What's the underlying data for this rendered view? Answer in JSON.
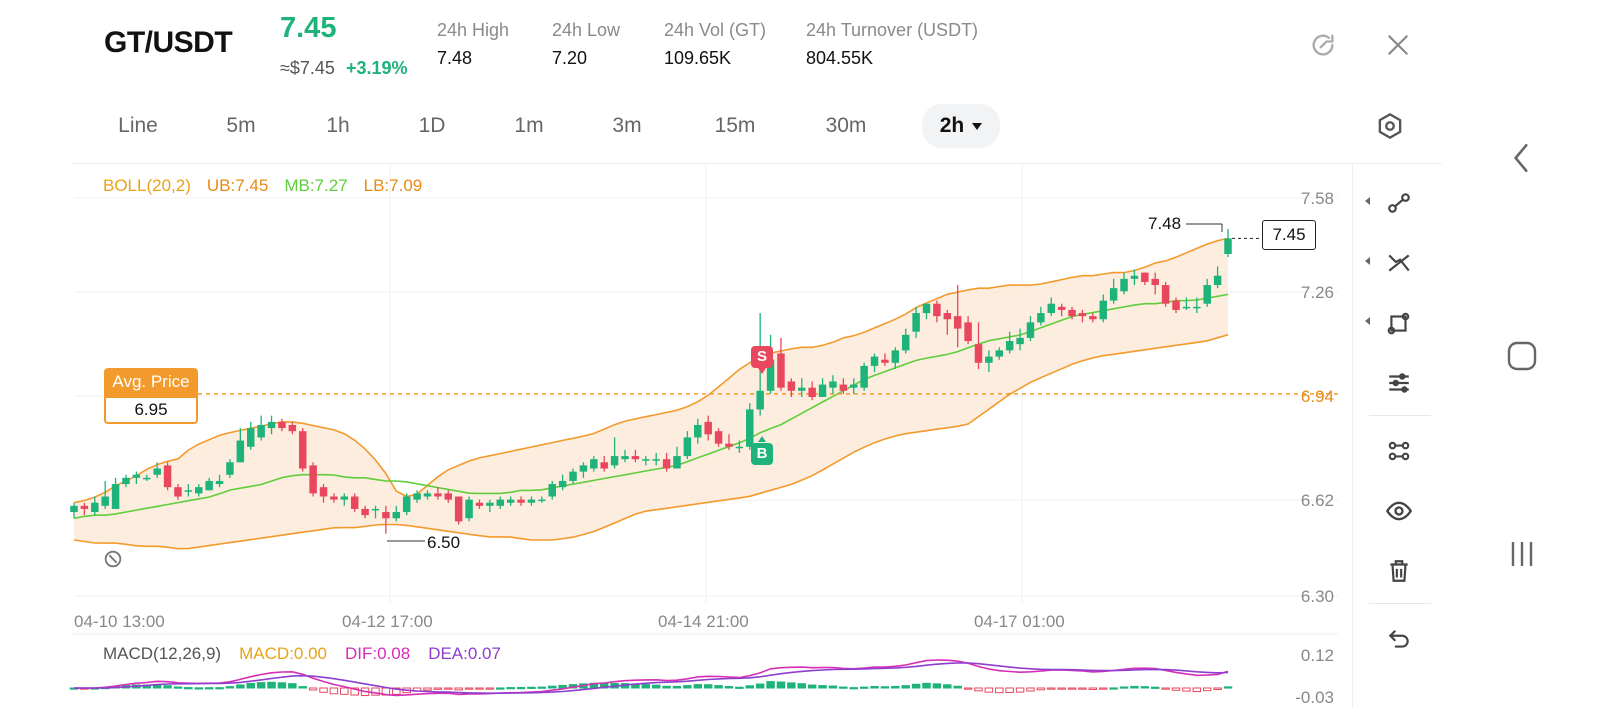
{
  "header": {
    "pair": "GT/USDT",
    "last_price": "7.45",
    "fiat_price": "≈$7.45",
    "change_pct": "+3.19%",
    "stats": [
      {
        "label": "24h   High",
        "value": "7.48"
      },
      {
        "label": "24h   Low",
        "value": "7.20"
      },
      {
        "label": "24h   Vol (GT)",
        "value": "109.65K"
      },
      {
        "label": "24h   Turnover (USDT)",
        "value": "804.55K"
      }
    ]
  },
  "tabs": [
    "Line",
    "5m",
    "1h",
    "1D",
    "1m",
    "3m",
    "15m",
    "30m",
    "2h"
  ],
  "active_tab": "2h",
  "indicators": {
    "boll": {
      "name": "BOLL(20,2)",
      "ub": "UB:7.45",
      "mb": "MB:7.27",
      "lb": "LB:7.09"
    },
    "macd": {
      "name": "MACD(12,26,9)",
      "macd": "MACD:0.00",
      "dif": "DIF:0.08",
      "dea": "DEA:0.07"
    }
  },
  "colors": {
    "up": "#1db37a",
    "down": "#e8475d",
    "boll_band": "#f39a2c",
    "boll_mid": "#5fcd3c",
    "boll_fill": "#fde9d6",
    "dif": "#d62fb4",
    "dea": "#8e3ecf",
    "boll_label": "#e8a317"
  },
  "chart": {
    "avg_price_label": "Avg. Price",
    "avg_price_value": "6.95",
    "current_price_tag": "7.45",
    "high_marker": "7.48",
    "low_marker": "6.50",
    "sell_marker": "S",
    "buy_marker": "B",
    "y_ticks": [
      "7.58",
      "7.26",
      "6.94",
      "6.62",
      "6.30"
    ],
    "x_ticks": [
      "04-10 13:00",
      "04-12 17:00",
      "04-14 21:00",
      "04-17 01:00"
    ],
    "macd_ticks": [
      "0.12",
      "-0.03"
    ]
  },
  "chart_data": {
    "type": "candlestick",
    "ylim": [
      6.3,
      7.58
    ],
    "macd_ylim": [
      -0.03,
      0.12
    ],
    "candles": [
      [
        6.57,
        6.59,
        6.55,
        6.6
      ],
      [
        6.59,
        6.58,
        6.56,
        6.6
      ],
      [
        6.57,
        6.6,
        6.56,
        6.62
      ],
      [
        6.59,
        6.62,
        6.58,
        6.67
      ],
      [
        6.58,
        6.66,
        6.58,
        6.68
      ],
      [
        6.66,
        6.68,
        6.65,
        6.69
      ],
      [
        6.68,
        6.69,
        6.66,
        6.7
      ],
      [
        6.68,
        6.68,
        6.67,
        6.69
      ],
      [
        6.69,
        6.71,
        6.68,
        6.73
      ],
      [
        6.72,
        6.65,
        6.64,
        6.73
      ],
      [
        6.65,
        6.62,
        6.61,
        6.66
      ],
      [
        6.64,
        6.64,
        6.62,
        6.66
      ],
      [
        6.63,
        6.65,
        6.62,
        6.66
      ],
      [
        6.64,
        6.67,
        6.64,
        6.68
      ],
      [
        6.66,
        6.67,
        6.65,
        6.69
      ],
      [
        6.69,
        6.73,
        6.68,
        6.74
      ],
      [
        6.73,
        6.8,
        6.73,
        6.84
      ],
      [
        6.78,
        6.84,
        6.77,
        6.86
      ],
      [
        6.81,
        6.85,
        6.8,
        6.88
      ],
      [
        6.84,
        6.86,
        6.82,
        6.88
      ],
      [
        6.86,
        6.84,
        6.83,
        6.87
      ],
      [
        6.85,
        6.83,
        6.82,
        6.86
      ],
      [
        6.83,
        6.71,
        6.7,
        6.84
      ],
      [
        6.72,
        6.63,
        6.62,
        6.73
      ],
      [
        6.65,
        6.62,
        6.6,
        6.66
      ],
      [
        6.62,
        6.61,
        6.6,
        6.63
      ],
      [
        6.61,
        6.62,
        6.59,
        6.63
      ],
      [
        6.62,
        6.58,
        6.57,
        6.63
      ],
      [
        6.58,
        6.56,
        6.55,
        6.59
      ],
      [
        6.58,
        6.58,
        6.55,
        6.59
      ],
      [
        6.57,
        6.55,
        6.5,
        6.59
      ],
      [
        6.55,
        6.57,
        6.54,
        6.59
      ],
      [
        6.57,
        6.62,
        6.56,
        6.63
      ],
      [
        6.61,
        6.63,
        6.6,
        6.64
      ],
      [
        6.62,
        6.63,
        6.61,
        6.64
      ],
      [
        6.63,
        6.62,
        6.61,
        6.65
      ],
      [
        6.63,
        6.61,
        6.6,
        6.64
      ],
      [
        6.62,
        6.54,
        6.53,
        6.62
      ],
      [
        6.55,
        6.61,
        6.54,
        6.62
      ],
      [
        6.6,
        6.59,
        6.58,
        6.61
      ],
      [
        6.59,
        6.6,
        6.57,
        6.61
      ],
      [
        6.59,
        6.61,
        6.58,
        6.62
      ],
      [
        6.6,
        6.61,
        6.59,
        6.62
      ],
      [
        6.61,
        6.6,
        6.59,
        6.62
      ],
      [
        6.6,
        6.61,
        6.59,
        6.62
      ],
      [
        6.61,
        6.61,
        6.6,
        6.62
      ],
      [
        6.62,
        6.66,
        6.61,
        6.67
      ],
      [
        6.65,
        6.67,
        6.64,
        6.69
      ],
      [
        6.67,
        6.7,
        6.66,
        6.71
      ],
      [
        6.7,
        6.72,
        6.68,
        6.73
      ],
      [
        6.71,
        6.74,
        6.7,
        6.75
      ],
      [
        6.73,
        6.71,
        6.7,
        6.75
      ],
      [
        6.72,
        6.75,
        6.71,
        6.81
      ],
      [
        6.74,
        6.75,
        6.73,
        6.77
      ],
      [
        6.75,
        6.74,
        6.73,
        6.77
      ],
      [
        6.74,
        6.74,
        6.72,
        6.75
      ],
      [
        6.74,
        6.74,
        6.72,
        6.76
      ],
      [
        6.74,
        6.71,
        6.7,
        6.76
      ],
      [
        6.71,
        6.75,
        6.71,
        6.78
      ],
      [
        6.75,
        6.81,
        6.74,
        6.83
      ],
      [
        6.81,
        6.85,
        6.79,
        6.87
      ],
      [
        6.86,
        6.82,
        6.8,
        6.88
      ],
      [
        6.83,
        6.79,
        6.78,
        6.84
      ],
      [
        6.79,
        6.78,
        6.77,
        6.82
      ],
      [
        6.78,
        6.78,
        6.76,
        6.8
      ],
      [
        6.78,
        6.9,
        6.77,
        6.92
      ],
      [
        6.9,
        6.96,
        6.88,
        7.21
      ],
      [
        6.96,
        7.06,
        6.95,
        7.14
      ],
      [
        7.08,
        6.97,
        6.96,
        7.13
      ],
      [
        6.99,
        6.96,
        6.94,
        7.0
      ],
      [
        6.96,
        6.97,
        6.94,
        7.0
      ],
      [
        6.97,
        6.94,
        6.93,
        6.99
      ],
      [
        6.94,
        6.98,
        6.94,
        7.0
      ],
      [
        6.97,
        6.99,
        6.95,
        7.01
      ],
      [
        6.98,
        6.96,
        6.95,
        7.0
      ],
      [
        6.97,
        6.98,
        6.95,
        7.0
      ],
      [
        6.97,
        7.04,
        6.96,
        7.05
      ],
      [
        7.04,
        7.07,
        7.02,
        7.08
      ],
      [
        7.06,
        7.05,
        7.04,
        7.08
      ],
      [
        7.05,
        7.09,
        7.03,
        7.1
      ],
      [
        7.09,
        7.14,
        7.08,
        7.16
      ],
      [
        7.15,
        7.21,
        7.13,
        7.23
      ],
      [
        7.21,
        7.24,
        7.19,
        7.24
      ],
      [
        7.24,
        7.2,
        7.18,
        7.25
      ],
      [
        7.21,
        7.19,
        7.14,
        7.22
      ],
      [
        7.2,
        7.16,
        7.1,
        7.3
      ],
      [
        7.18,
        7.12,
        7.11,
        7.2
      ],
      [
        7.11,
        7.05,
        7.03,
        7.18
      ],
      [
        7.05,
        7.07,
        7.02,
        7.09
      ],
      [
        7.07,
        7.09,
        7.06,
        7.1
      ],
      [
        7.09,
        7.12,
        7.08,
        7.15
      ],
      [
        7.11,
        7.13,
        7.09,
        7.16
      ],
      [
        7.13,
        7.18,
        7.12,
        7.2
      ],
      [
        7.18,
        7.21,
        7.17,
        7.23
      ],
      [
        7.21,
        7.24,
        7.2,
        7.26
      ],
      [
        7.23,
        7.22,
        7.2,
        7.24
      ],
      [
        7.22,
        7.2,
        7.19,
        7.23
      ],
      [
        7.21,
        7.2,
        7.18,
        7.22
      ],
      [
        7.2,
        7.19,
        7.18,
        7.21
      ],
      [
        7.19,
        7.25,
        7.18,
        7.27
      ],
      [
        7.25,
        7.29,
        7.24,
        7.32
      ],
      [
        7.28,
        7.32,
        7.27,
        7.34
      ],
      [
        7.32,
        7.33,
        7.3,
        7.35
      ],
      [
        7.34,
        7.31,
        7.3,
        7.34
      ],
      [
        7.32,
        7.3,
        7.27,
        7.34
      ],
      [
        7.3,
        7.24,
        7.23,
        7.31
      ],
      [
        7.25,
        7.22,
        7.21,
        7.26
      ],
      [
        7.23,
        7.23,
        7.22,
        7.26
      ],
      [
        7.23,
        7.23,
        7.21,
        7.26
      ],
      [
        7.24,
        7.3,
        7.23,
        7.32
      ],
      [
        7.3,
        7.33,
        7.29,
        7.36
      ],
      [
        7.4,
        7.45,
        7.39,
        7.48
      ]
    ],
    "boll_ub": [
      6.6,
      6.61,
      6.63,
      6.66,
      6.68,
      6.71,
      6.73,
      6.74,
      6.78,
      6.8,
      6.82,
      6.83,
      6.84,
      6.85,
      6.86,
      6.86,
      6.85,
      6.84,
      6.83,
      6.8,
      6.76,
      6.7,
      6.62,
      6.62,
      6.66,
      6.7,
      6.72,
      6.74,
      6.75,
      6.76,
      6.77,
      6.78,
      6.79,
      6.8,
      6.81,
      6.82,
      6.84,
      6.86,
      6.87,
      6.88,
      6.89,
      6.9,
      6.92,
      6.95,
      6.99,
      7.03,
      7.06,
      7.08,
      7.09,
      7.1,
      7.1,
      7.11,
      7.13,
      7.14,
      7.16,
      7.18,
      7.2,
      7.23,
      7.25,
      7.27,
      7.28,
      7.29,
      7.29,
      7.3,
      7.3,
      7.3,
      7.31,
      7.32,
      7.33,
      7.33,
      7.34,
      7.34,
      7.35,
      7.37,
      7.38,
      7.4,
      7.42,
      7.44,
      7.45
    ],
    "boll_mb": [
      6.55,
      6.56,
      6.56,
      6.57,
      6.58,
      6.59,
      6.6,
      6.61,
      6.62,
      6.64,
      6.65,
      6.66,
      6.68,
      6.69,
      6.69,
      6.69,
      6.68,
      6.68,
      6.67,
      6.67,
      6.66,
      6.65,
      6.64,
      6.63,
      6.63,
      6.63,
      6.64,
      6.64,
      6.65,
      6.66,
      6.67,
      6.68,
      6.69,
      6.7,
      6.71,
      6.72,
      6.74,
      6.76,
      6.78,
      6.8,
      6.83,
      6.85,
      6.88,
      6.91,
      6.94,
      6.97,
      7.0,
      7.02,
      7.04,
      7.06,
      7.07,
      7.08,
      7.1,
      7.12,
      7.13,
      7.14,
      7.16,
      7.18,
      7.2,
      7.21,
      7.22,
      7.23,
      7.24,
      7.24,
      7.25,
      7.25,
      7.26,
      7.27
    ],
    "boll_lb": [
      6.48,
      6.47,
      6.47,
      6.46,
      6.46,
      6.45,
      6.46,
      6.47,
      6.48,
      6.49,
      6.5,
      6.51,
      6.52,
      6.52,
      6.53,
      6.53,
      6.52,
      6.51,
      6.5,
      6.49,
      6.49,
      6.48,
      6.48,
      6.49,
      6.51,
      6.54,
      6.57,
      6.58,
      6.59,
      6.6,
      6.61,
      6.62,
      6.64,
      6.66,
      6.69,
      6.73,
      6.77,
      6.8,
      6.82,
      6.83,
      6.84,
      6.85,
      6.9,
      6.95,
      6.99,
      7.02,
      7.05,
      7.07,
      7.08,
      7.09,
      7.1,
      7.11,
      7.12,
      7.14
    ]
  }
}
